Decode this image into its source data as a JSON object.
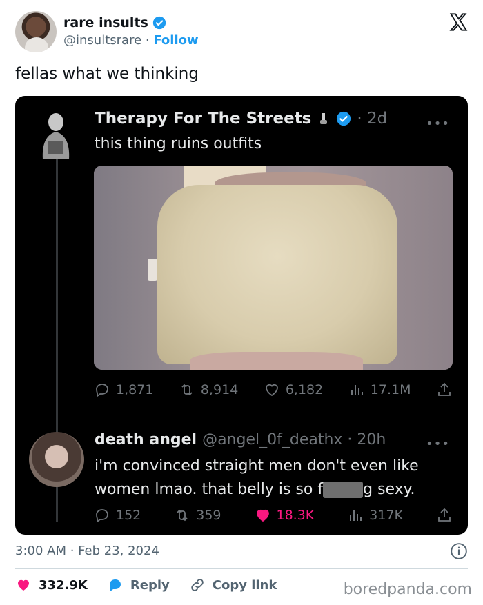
{
  "author": {
    "name": "rare insults",
    "handle": "@insultsrare",
    "separator": "·",
    "follow_label": "Follow"
  },
  "tweet": {
    "text": "fellas what we thinking",
    "timestamp": "3:00 AM · Feb 23, 2024"
  },
  "quoted_post": {
    "name": "Therapy For The Streets",
    "time": "· 2d",
    "text": "this thing ruins outfits",
    "more": "•••",
    "stats": {
      "replies": "1,871",
      "reposts": "8,914",
      "likes": "6,182",
      "views": "17.1M"
    }
  },
  "reply_post": {
    "name": "death angel",
    "handle_time": "@angel_0f_deathx · 20h",
    "text_before": "i'm convinced straight men don't even like women lmao. that belly is so f",
    "text_after": "g sexy.",
    "more": "•••",
    "stats": {
      "replies": "152",
      "reposts": "359",
      "likes": "18.3K",
      "views": "317K"
    }
  },
  "footer": {
    "likes": "332.9K",
    "reply_label": "Reply",
    "copy_label": "Copy link",
    "watermark": "boredpanda.com"
  },
  "colors": {
    "accent": "#1d9bf0",
    "like": "#f91880",
    "quote_bg": "#000000"
  },
  "icons": [
    "verified-badge-icon",
    "x-logo-icon",
    "reply-icon",
    "repost-icon",
    "heart-icon",
    "views-icon",
    "share-icon",
    "info-icon",
    "link-icon"
  ]
}
